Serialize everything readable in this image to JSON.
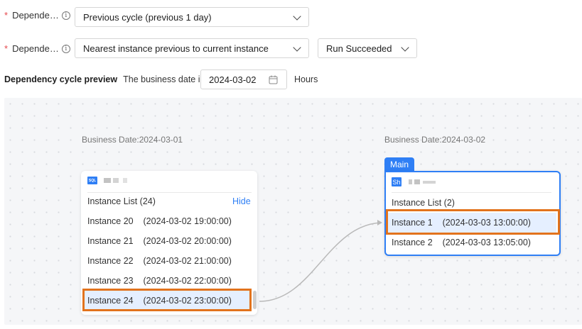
{
  "row1": {
    "label": "Depende…",
    "value": "Previous cycle (previous 1 day)"
  },
  "row2": {
    "label": "Depende…",
    "value": "Nearest instance previous to current instance",
    "status": "Run Succeeded"
  },
  "preview": {
    "title": "Dependency cycle preview",
    "business_text": "The business date is",
    "date": "2024-03-02",
    "unit": "Hours"
  },
  "left_node": {
    "business_date": "Business Date:2024-03-01",
    "icon_label": "SQL",
    "list_title": "Instance List (24)",
    "hide_label": "Hide",
    "instances": [
      "Instance 20    (2024-03-02 19:00:00)",
      "Instance 21    (2024-03-02 20:00:00)",
      "Instance 22    (2024-03-02 21:00:00)",
      "Instance 23    (2024-03-02 22:00:00)",
      "Instance 24    (2024-03-02 23:00:00)"
    ]
  },
  "right_node": {
    "business_date": "Business Date:2024-03-02",
    "tag": "Main",
    "icon_label": "Sh",
    "list_title": "Instance List (2)",
    "instances": [
      "Instance 1    (2024-03-03 13:00:00)",
      "Instance 2    (2024-03-03 13:05:00)"
    ]
  },
  "colors": {
    "accent": "#2f7ff5",
    "highlight": "#e2731d",
    "required": "#e5484d"
  }
}
